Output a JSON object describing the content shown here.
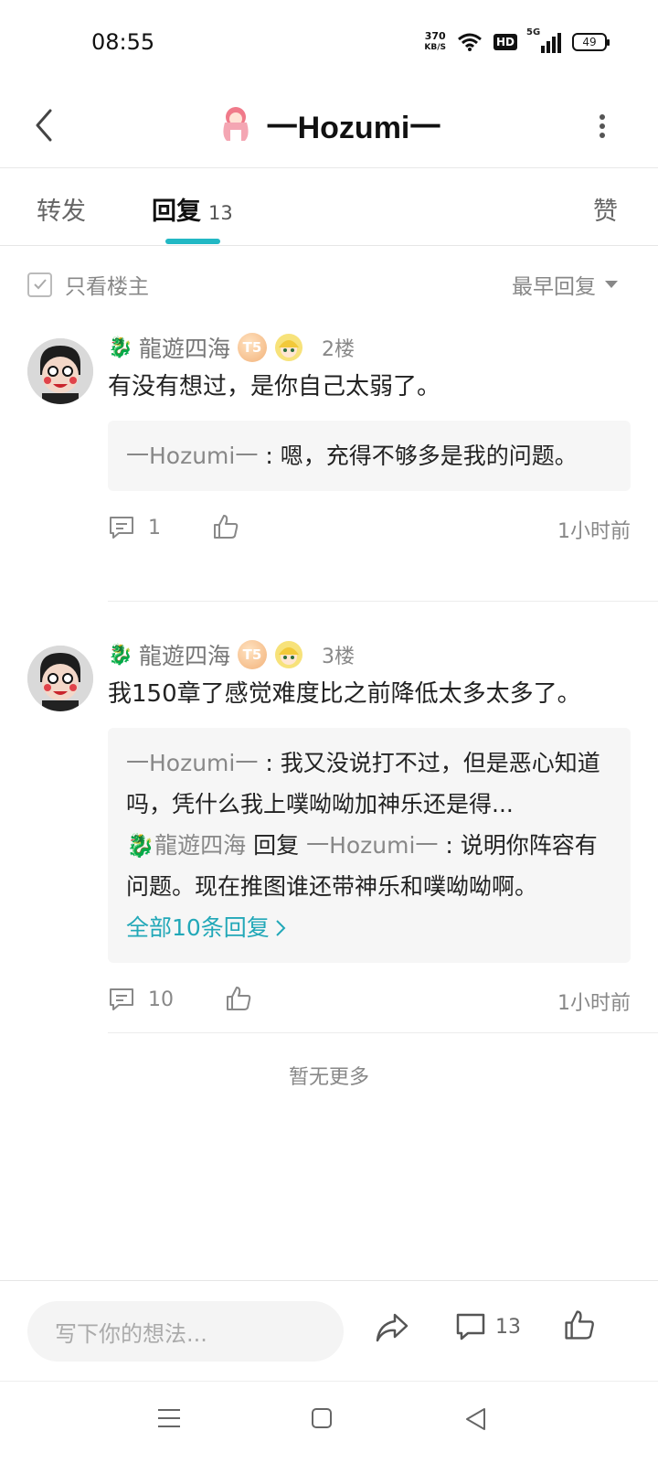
{
  "status": {
    "time": "08:55",
    "net_speed_value": "370",
    "net_speed_unit": "KB/S",
    "hd": "HD",
    "network": "5G",
    "battery": "49"
  },
  "header": {
    "title": "一Hozumi一"
  },
  "tabs": {
    "forward": "转发",
    "reply": "回复",
    "reply_count": "13",
    "like": "赞"
  },
  "filter": {
    "only_op": "只看楼主",
    "sort": "最早回复"
  },
  "comments": [
    {
      "username": "龍遊四海",
      "badge": "T5",
      "floor": "2楼",
      "text": "有没有想过，是你自己太弱了。",
      "replies": [
        {
          "name": "一Hozumi一",
          "text": " : 嗯，充得不够多是我的问题。"
        }
      ],
      "comment_count": "1",
      "time": "1小时前"
    },
    {
      "username": "龍遊四海",
      "badge": "T5",
      "floor": "3楼",
      "text": "我150章了感觉难度比之前降低太多太多了。",
      "replies": [
        {
          "name": "一Hozumi一",
          "text": " : 我又没说打不过，但是恶心知道吗，凭什么我上噗呦呦加神乐还是得..."
        },
        {
          "name": "龍遊四海",
          "connector": " 回复 ",
          "target": "一Hozumi一",
          "text": " : 说明你阵容有问题。现在推图谁还带神乐和噗呦呦啊。"
        }
      ],
      "all_replies": "全部10条回复",
      "comment_count": "10",
      "time": "1小时前"
    }
  ],
  "no_more": "暂无更多",
  "bottom": {
    "input_placeholder": "写下你的想法...",
    "comment_count": "13"
  },
  "colors": {
    "accent": "#22b8c4",
    "link": "#22a8b8"
  }
}
